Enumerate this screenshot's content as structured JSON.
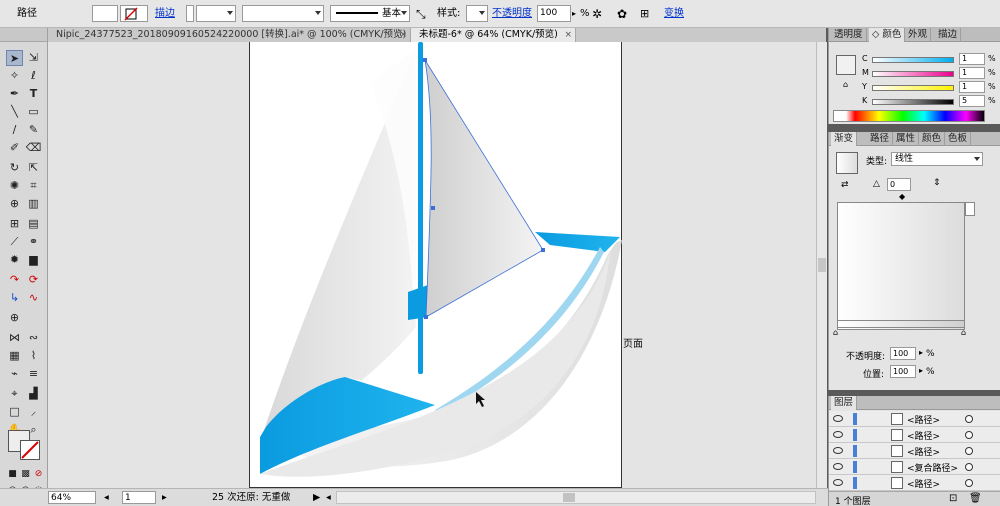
{
  "control_bar": {
    "selection_label": "路径",
    "stroke_label": "描边",
    "brush_label": "基本",
    "style_label": "样式:",
    "opacity_label": "不透明度",
    "opacity_value": "100",
    "opacity_unit": "%",
    "transform_label": "变换"
  },
  "tabs": [
    {
      "label": "Nipic_24377523_20180909160524220000 [转换].ai* @ 100% (CMYK/预览)",
      "close": "×",
      "active": false
    },
    {
      "label": "未标题-6* @ 64% (CMYK/预览)",
      "close": "×",
      "active": true
    }
  ],
  "canvas": {
    "page_label": "页面"
  },
  "status_bar": {
    "zoom": "64%",
    "artboard": "1",
    "undo_text": "25 次还原: 无重做"
  },
  "color_panel": {
    "tabs": [
      "透明度",
      "颜色",
      "外观",
      "描边"
    ],
    "active_tab": "颜色",
    "channels": [
      {
        "label": "C",
        "value": "1",
        "unit": "%"
      },
      {
        "label": "M",
        "value": "1",
        "unit": "%"
      },
      {
        "label": "Y",
        "value": "1",
        "unit": "%"
      },
      {
        "label": "K",
        "value": "5",
        "unit": "%"
      }
    ]
  },
  "gradient_panel": {
    "tabs": [
      "渐变",
      "路径",
      "属性",
      "颜色",
      "色板"
    ],
    "active_tab": "渐变",
    "type_label": "类型:",
    "type_value": "线性",
    "angle_value": "0",
    "opacity_label": "不透明度:",
    "opacity_value": "100",
    "location_label": "位置:",
    "location_value": "100",
    "unit": "%"
  },
  "layers_panel": {
    "title": "图层",
    "rows": [
      {
        "name": "<路径>"
      },
      {
        "name": "<路径>"
      },
      {
        "name": "<路径>"
      },
      {
        "name": "<复合路径>"
      },
      {
        "name": "<路径>"
      }
    ],
    "footer": "1 个图层"
  },
  "colors": {
    "accent": "#0a9be0",
    "panel_bg": "#e4e4e4",
    "canvas_bg": "#e4e4e4"
  }
}
